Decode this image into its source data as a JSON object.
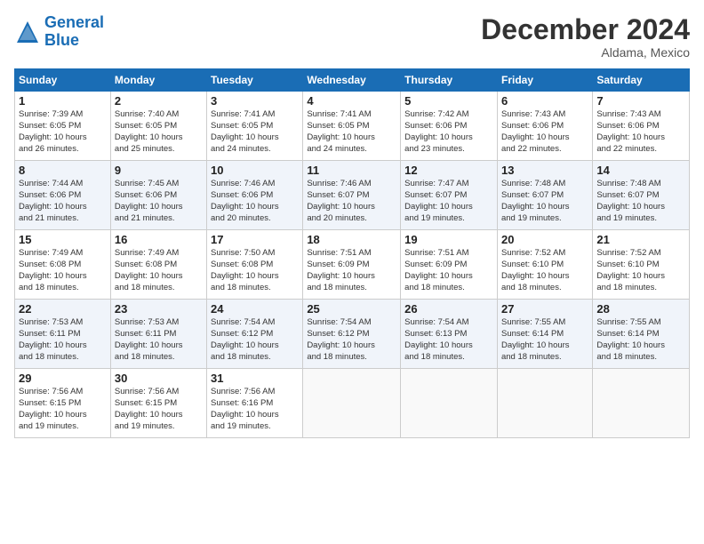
{
  "header": {
    "logo_line1": "General",
    "logo_line2": "Blue",
    "month": "December 2024",
    "location": "Aldama, Mexico"
  },
  "days_of_week": [
    "Sunday",
    "Monday",
    "Tuesday",
    "Wednesday",
    "Thursday",
    "Friday",
    "Saturday"
  ],
  "weeks": [
    [
      {
        "day": "1",
        "info": "Sunrise: 7:39 AM\nSunset: 6:05 PM\nDaylight: 10 hours\nand 26 minutes."
      },
      {
        "day": "2",
        "info": "Sunrise: 7:40 AM\nSunset: 6:05 PM\nDaylight: 10 hours\nand 25 minutes."
      },
      {
        "day": "3",
        "info": "Sunrise: 7:41 AM\nSunset: 6:05 PM\nDaylight: 10 hours\nand 24 minutes."
      },
      {
        "day": "4",
        "info": "Sunrise: 7:41 AM\nSunset: 6:05 PM\nDaylight: 10 hours\nand 24 minutes."
      },
      {
        "day": "5",
        "info": "Sunrise: 7:42 AM\nSunset: 6:06 PM\nDaylight: 10 hours\nand 23 minutes."
      },
      {
        "day": "6",
        "info": "Sunrise: 7:43 AM\nSunset: 6:06 PM\nDaylight: 10 hours\nand 22 minutes."
      },
      {
        "day": "7",
        "info": "Sunrise: 7:43 AM\nSunset: 6:06 PM\nDaylight: 10 hours\nand 22 minutes."
      }
    ],
    [
      {
        "day": "8",
        "info": "Sunrise: 7:44 AM\nSunset: 6:06 PM\nDaylight: 10 hours\nand 21 minutes."
      },
      {
        "day": "9",
        "info": "Sunrise: 7:45 AM\nSunset: 6:06 PM\nDaylight: 10 hours\nand 21 minutes."
      },
      {
        "day": "10",
        "info": "Sunrise: 7:46 AM\nSunset: 6:06 PM\nDaylight: 10 hours\nand 20 minutes."
      },
      {
        "day": "11",
        "info": "Sunrise: 7:46 AM\nSunset: 6:07 PM\nDaylight: 10 hours\nand 20 minutes."
      },
      {
        "day": "12",
        "info": "Sunrise: 7:47 AM\nSunset: 6:07 PM\nDaylight: 10 hours\nand 19 minutes."
      },
      {
        "day": "13",
        "info": "Sunrise: 7:48 AM\nSunset: 6:07 PM\nDaylight: 10 hours\nand 19 minutes."
      },
      {
        "day": "14",
        "info": "Sunrise: 7:48 AM\nSunset: 6:07 PM\nDaylight: 10 hours\nand 19 minutes."
      }
    ],
    [
      {
        "day": "15",
        "info": "Sunrise: 7:49 AM\nSunset: 6:08 PM\nDaylight: 10 hours\nand 18 minutes."
      },
      {
        "day": "16",
        "info": "Sunrise: 7:49 AM\nSunset: 6:08 PM\nDaylight: 10 hours\nand 18 minutes."
      },
      {
        "day": "17",
        "info": "Sunrise: 7:50 AM\nSunset: 6:08 PM\nDaylight: 10 hours\nand 18 minutes."
      },
      {
        "day": "18",
        "info": "Sunrise: 7:51 AM\nSunset: 6:09 PM\nDaylight: 10 hours\nand 18 minutes."
      },
      {
        "day": "19",
        "info": "Sunrise: 7:51 AM\nSunset: 6:09 PM\nDaylight: 10 hours\nand 18 minutes."
      },
      {
        "day": "20",
        "info": "Sunrise: 7:52 AM\nSunset: 6:10 PM\nDaylight: 10 hours\nand 18 minutes."
      },
      {
        "day": "21",
        "info": "Sunrise: 7:52 AM\nSunset: 6:10 PM\nDaylight: 10 hours\nand 18 minutes."
      }
    ],
    [
      {
        "day": "22",
        "info": "Sunrise: 7:53 AM\nSunset: 6:11 PM\nDaylight: 10 hours\nand 18 minutes."
      },
      {
        "day": "23",
        "info": "Sunrise: 7:53 AM\nSunset: 6:11 PM\nDaylight: 10 hours\nand 18 minutes."
      },
      {
        "day": "24",
        "info": "Sunrise: 7:54 AM\nSunset: 6:12 PM\nDaylight: 10 hours\nand 18 minutes."
      },
      {
        "day": "25",
        "info": "Sunrise: 7:54 AM\nSunset: 6:12 PM\nDaylight: 10 hours\nand 18 minutes."
      },
      {
        "day": "26",
        "info": "Sunrise: 7:54 AM\nSunset: 6:13 PM\nDaylight: 10 hours\nand 18 minutes."
      },
      {
        "day": "27",
        "info": "Sunrise: 7:55 AM\nSunset: 6:14 PM\nDaylight: 10 hours\nand 18 minutes."
      },
      {
        "day": "28",
        "info": "Sunrise: 7:55 AM\nSunset: 6:14 PM\nDaylight: 10 hours\nand 18 minutes."
      }
    ],
    [
      {
        "day": "29",
        "info": "Sunrise: 7:56 AM\nSunset: 6:15 PM\nDaylight: 10 hours\nand 19 minutes."
      },
      {
        "day": "30",
        "info": "Sunrise: 7:56 AM\nSunset: 6:15 PM\nDaylight: 10 hours\nand 19 minutes."
      },
      {
        "day": "31",
        "info": "Sunrise: 7:56 AM\nSunset: 6:16 PM\nDaylight: 10 hours\nand 19 minutes."
      },
      {
        "day": "",
        "info": ""
      },
      {
        "day": "",
        "info": ""
      },
      {
        "day": "",
        "info": ""
      },
      {
        "day": "",
        "info": ""
      }
    ]
  ]
}
